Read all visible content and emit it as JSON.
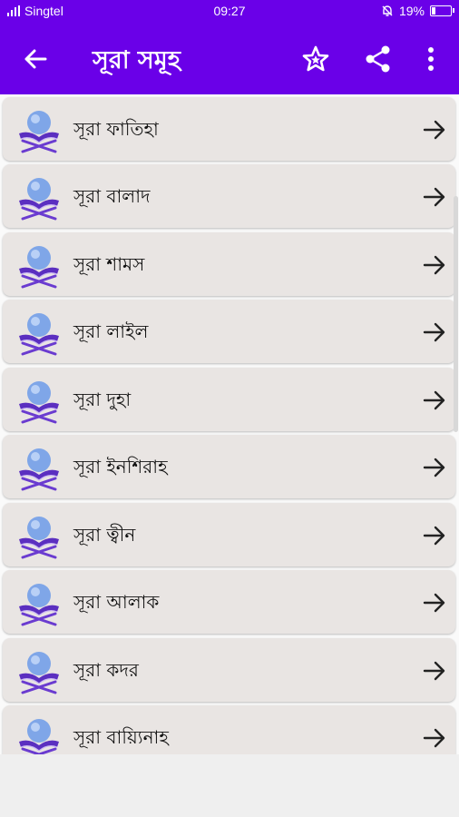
{
  "status": {
    "carrier": "Singtel",
    "time": "09:27",
    "battery": "19%",
    "battery_level": 0.19
  },
  "appbar": {
    "title": "সূরা সমূহ",
    "back_icon": "arrow-left-icon",
    "favorite_icon": "star-icon",
    "share_icon": "share-icon",
    "menu_icon": "more-vert-icon"
  },
  "list": {
    "items": [
      {
        "label": "সূরা ফাতিহা"
      },
      {
        "label": "সূরা বালাদ"
      },
      {
        "label": "সূরা শামস"
      },
      {
        "label": "সূরা লাইল"
      },
      {
        "label": "সূরা দুহা"
      },
      {
        "label": "সূরা ইনশিরাহ"
      },
      {
        "label": "সূরা ত্বীন"
      },
      {
        "label": "সূরা আলাক"
      },
      {
        "label": "সূরা কদর"
      },
      {
        "label": "সূরা বায়্যিনাহ"
      }
    ]
  },
  "colors": {
    "primary": "#6a00e8",
    "card": "#e9e5e3"
  }
}
